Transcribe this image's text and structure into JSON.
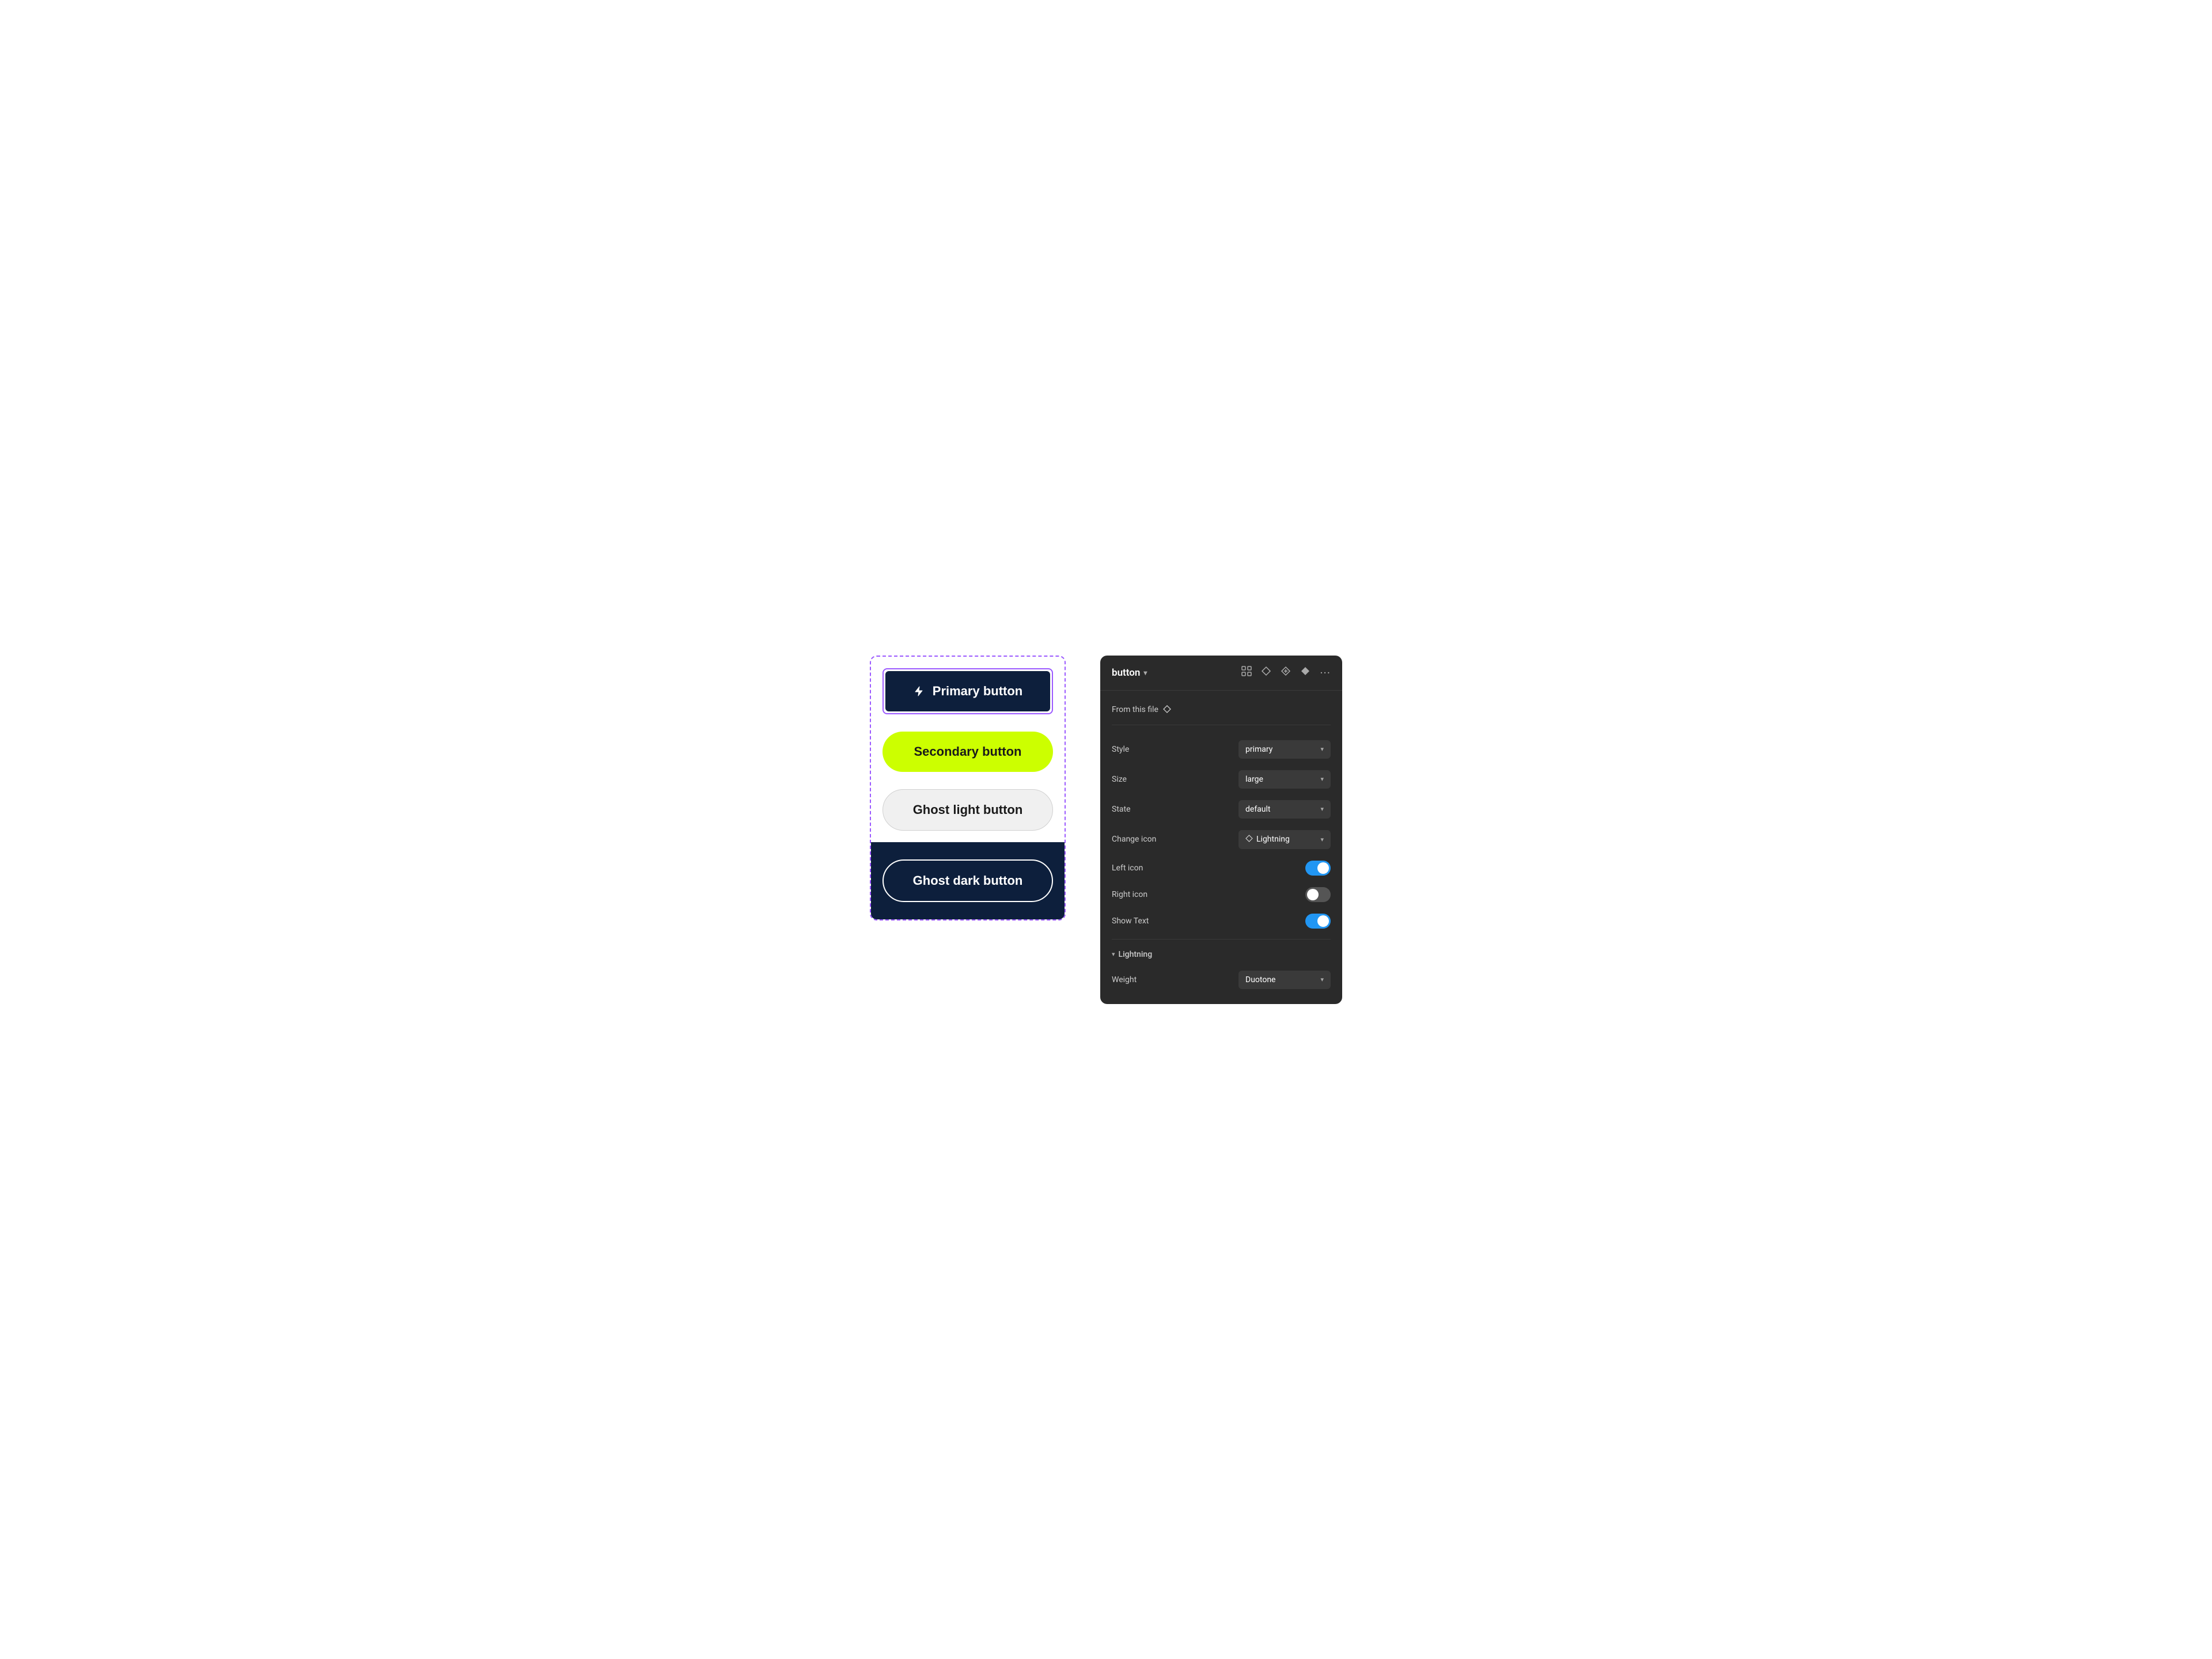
{
  "left": {
    "primary_btn_label": "Primary button",
    "secondary_btn_label": "Secondary button",
    "ghost_light_btn_label": "Ghost light button",
    "ghost_dark_btn_label": "Ghost dark button"
  },
  "right": {
    "title": "button",
    "title_chevron": "▾",
    "from_this_file": "From this file",
    "props": {
      "style_label": "Style",
      "style_value": "primary",
      "size_label": "Size",
      "size_value": "large",
      "state_label": "State",
      "state_value": "default",
      "change_icon_label": "Change icon",
      "change_icon_value": "Lightning",
      "left_icon_label": "Left icon",
      "right_icon_label": "Right icon",
      "show_text_label": "Show Text"
    },
    "lightning_section": {
      "label": "Lightning",
      "weight_label": "Weight",
      "weight_value": "Duotone"
    },
    "icons": {
      "grid": "⊞",
      "diamond1": "◇",
      "diamond2": "◈",
      "diamond3": "◆",
      "more": "···"
    }
  }
}
